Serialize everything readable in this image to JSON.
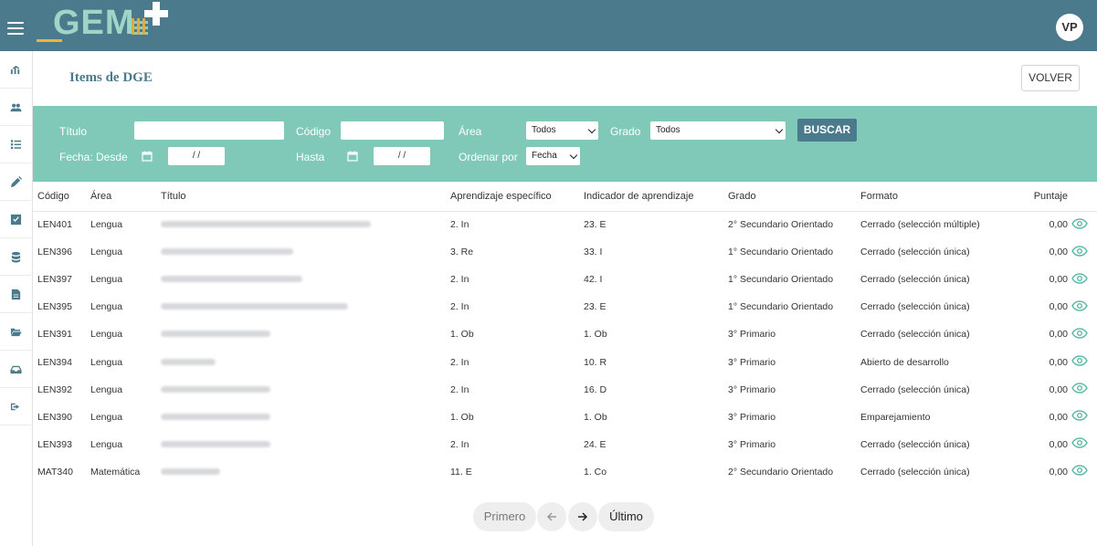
{
  "header": {
    "avatar_initials": "VP",
    "logo_text": "GEM"
  },
  "page": {
    "title": "Items de DGE",
    "back_button": "VOLVER"
  },
  "filters": {
    "titulo_label": "Título",
    "codigo_label": "Código",
    "area_label": "Área",
    "area_value": "Todos",
    "grado_label": "Grado",
    "grado_value": "Todos",
    "buscar_button": "BUSCAR",
    "fecha_desde_label": "Fecha: Desde",
    "hasta_label": "Hasta",
    "date_placeholder": "/ /",
    "ordenar_label": "Ordenar por",
    "ordenar_value": "Fecha"
  },
  "table": {
    "headers": [
      "Código",
      "Área",
      "Título",
      "Aprendizaje específico",
      "Indicador de aprendizaje",
      "Grado",
      "Formato",
      "Puntaje"
    ],
    "rows": [
      {
        "codigo": "LEN401",
        "area": "Lengua",
        "aprendizaje": "2. In",
        "indicador": "23. E",
        "grado": "2° Secundario Orientado",
        "formato": "Cerrado (selección múltiple)",
        "puntaje": "0,00"
      },
      {
        "codigo": "LEN396",
        "area": "Lengua",
        "aprendizaje": "3. Re",
        "indicador": "33. I",
        "grado": "1° Secundario Orientado",
        "formato": "Cerrado (selección única)",
        "puntaje": "0,00"
      },
      {
        "codigo": "LEN397",
        "area": "Lengua",
        "aprendizaje": "2. In",
        "indicador": "42. I",
        "grado": "1° Secundario Orientado",
        "formato": "Cerrado (selección única)",
        "puntaje": "0,00"
      },
      {
        "codigo": "LEN395",
        "area": "Lengua",
        "aprendizaje": "2. In",
        "indicador": "23. E",
        "grado": "1° Secundario Orientado",
        "formato": "Cerrado (selección única)",
        "puntaje": "0,00"
      },
      {
        "codigo": "LEN391",
        "area": "Lengua",
        "aprendizaje": "1. Ob",
        "indicador": "1. Ob",
        "grado": "3° Primario",
        "formato": "Cerrado (selección única)",
        "puntaje": "0,00"
      },
      {
        "codigo": "LEN394",
        "area": "Lengua",
        "aprendizaje": "2. In",
        "indicador": "10. R",
        "grado": "3° Primario",
        "formato": "Abierto de desarrollo",
        "puntaje": "0,00"
      },
      {
        "codigo": "LEN392",
        "area": "Lengua",
        "aprendizaje": "2. In",
        "indicador": "16. D",
        "grado": "3° Primario",
        "formato": "Cerrado (selección única)",
        "puntaje": "0,00"
      },
      {
        "codigo": "LEN390",
        "area": "Lengua",
        "aprendizaje": "1. Ob",
        "indicador": "1. Ob",
        "grado": "3° Primario",
        "formato": "Emparejamiento",
        "puntaje": "0,00"
      },
      {
        "codigo": "LEN393",
        "area": "Lengua",
        "aprendizaje": "2. In",
        "indicador": "24. E",
        "grado": "3° Primario",
        "formato": "Cerrado (selección única)",
        "puntaje": "0,00"
      },
      {
        "codigo": "MAT340",
        "area": "Matemática",
        "aprendizaje": "11. E",
        "indicador": "1. Co",
        "grado": "2° Secundario Orientado",
        "formato": "Cerrado (selección única)",
        "puntaje": "0,00"
      }
    ]
  },
  "pagination": {
    "first": "Primero",
    "last": "Último"
  },
  "colors": {
    "header_bg": "#4a7a8c",
    "filter_bg": "#80c9b9",
    "accent": "#5bb8a6",
    "logo_yellow": "#f2b233"
  }
}
